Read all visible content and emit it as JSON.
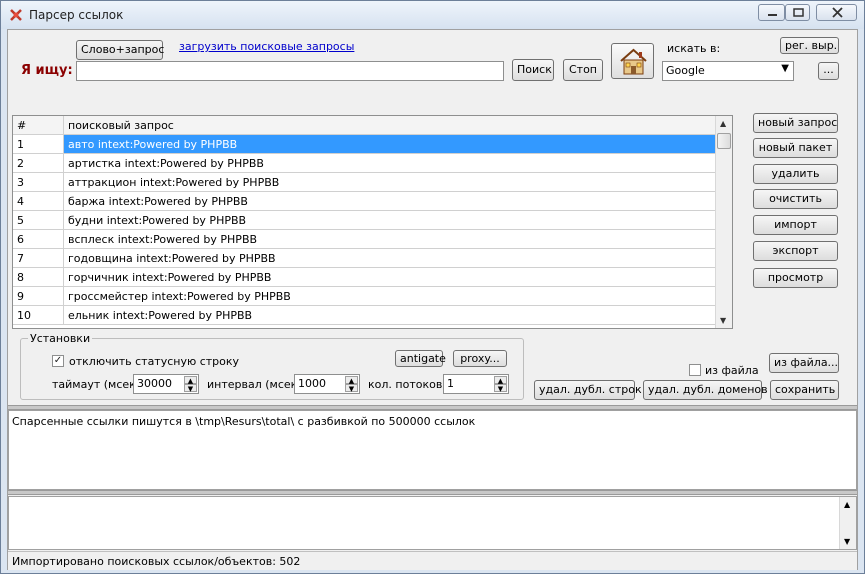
{
  "window": {
    "title": "Парсер ссылок"
  },
  "toolbar": {
    "word_query_button": "Слово+запрос",
    "load_queries_link": "загрузить поисковые запросы",
    "search_label": "Я ищу:",
    "search_value": "",
    "search_button": "Поиск",
    "stop_button": "Стоп",
    "search_in_label": "искать в:",
    "engine_selected": "Google",
    "regex_button": "рег. выр.",
    "more_button": "..."
  },
  "grid": {
    "header": {
      "num": "#",
      "query": "поисковый запрос"
    },
    "rows": [
      {
        "num": "1",
        "query": "авто intext:Powered by PHPBB"
      },
      {
        "num": "2",
        "query": "артистка intext:Powered by PHPBB"
      },
      {
        "num": "3",
        "query": "аттракцион intext:Powered by PHPBB"
      },
      {
        "num": "4",
        "query": "баржа intext:Powered by PHPBB"
      },
      {
        "num": "5",
        "query": "будни intext:Powered by PHPBB"
      },
      {
        "num": "6",
        "query": "всплеск intext:Powered by PHPBB"
      },
      {
        "num": "7",
        "query": "годовщина intext:Powered by PHPBB"
      },
      {
        "num": "8",
        "query": "горчичник intext:Powered by PHPBB"
      },
      {
        "num": "9",
        "query": "гроссмейстер intext:Powered by PHPBB"
      },
      {
        "num": "10",
        "query": "ельник intext:Powered by PHPBB"
      }
    ],
    "selected_row": "1"
  },
  "side_buttons": {
    "new_query": "новый запрос",
    "new_packet": "новый пакет",
    "delete": "удалить",
    "clear": "очистить",
    "import": "импорт",
    "export": "экспорт",
    "view": "просмотр"
  },
  "settings": {
    "group_title": "Установки",
    "disable_status_label": "отключить статусную строку",
    "disable_status_checked": true,
    "antigate_button": "antigate",
    "proxy_button": "proxy...",
    "timeout_label": "таймаут (мсек)",
    "timeout_value": "30000",
    "interval_label": "интервал (мсек)",
    "interval_value": "1000",
    "threads_label": "кол. потоков",
    "threads_value": "1"
  },
  "file_panel": {
    "from_file_checkbox_label": "из файла",
    "from_file_checked": false,
    "from_file_button": "из файла...",
    "dedupe_lines_button": "удал. дубл. строк",
    "dedupe_domains_button": "удал. дубл. доменов",
    "save_button": "сохранить"
  },
  "log": {
    "message": "Спарсенные ссылки пишутся в \\tmp\\Resurs\\total\\ с разбивкой по 500000 ссылок"
  },
  "status": {
    "text": "Импортировано поисковых ссылок/объектов: 502"
  },
  "colors": {
    "selection": "#3399ff",
    "search_label": "#8b0000",
    "link": "#0000cc"
  }
}
